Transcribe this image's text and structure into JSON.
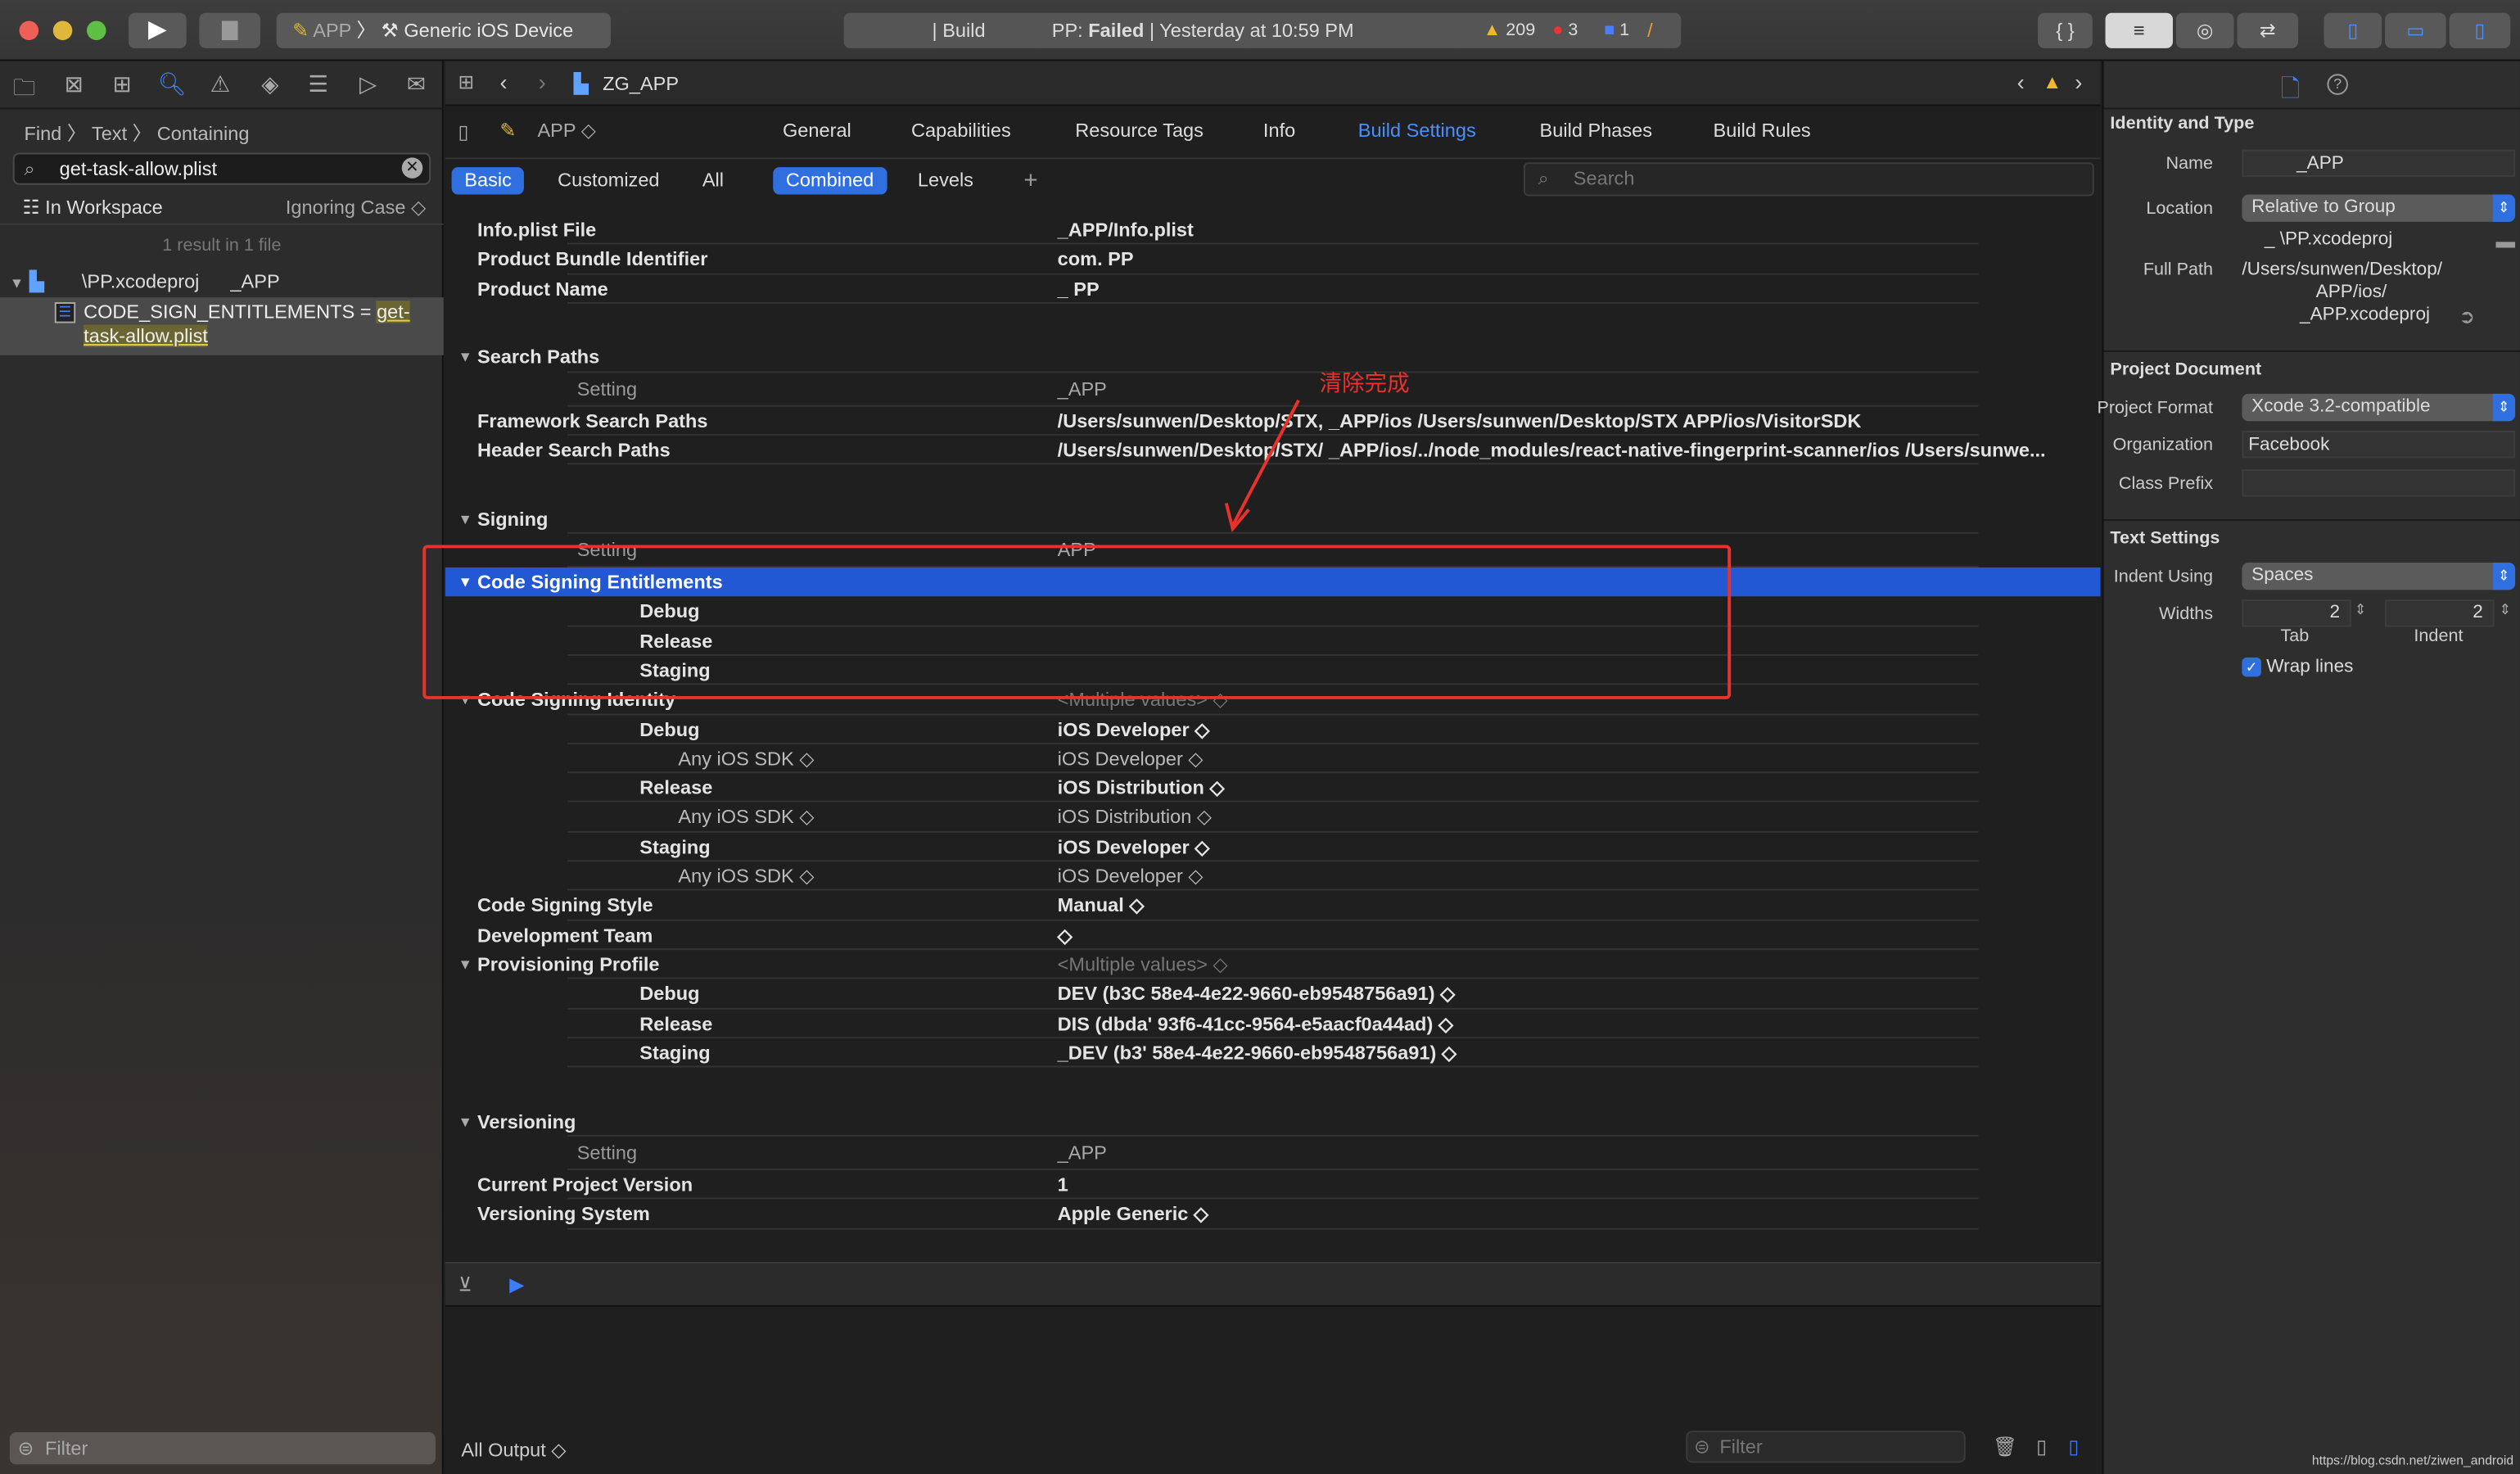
{
  "titlebar": {
    "scheme": "APP",
    "device": "Generic iOS Device",
    "activity": {
      "prefix": "| Build",
      "project": "PP:",
      "status": "Failed",
      "time": "| Yesterday at 10:59 PM"
    },
    "warnings": "209",
    "errors": "3",
    "issues": "1"
  },
  "navigator": {
    "breadcrumb": [
      "Find",
      "Text",
      "Containing"
    ],
    "search_value": "get-task-allow.plist",
    "scope": "In Workspace",
    "case": "Ignoring Case",
    "result_summary": "1 result in 1 file",
    "result_file": "\\PP.xcodeproj",
    "result_file_target": "_APP",
    "result_match_prefix": "CODE_SIGN_ENTITLEMENTS = ",
    "result_match_highlight": "get-task-allow.plist",
    "filter_placeholder": "Filter"
  },
  "editor": {
    "jump_file": "ZG_APP",
    "target": "APP",
    "tabs": [
      "General",
      "Capabilities",
      "Resource Tags",
      "Info",
      "Build Settings",
      "Build Phases",
      "Build Rules"
    ],
    "active_tab": "Build Settings",
    "filters": [
      "Basic",
      "Customized",
      "All"
    ],
    "active_filter": "Basic",
    "views": [
      "Combined",
      "Levels"
    ],
    "active_view": "Combined",
    "add": "+",
    "search_placeholder": "Search",
    "rows": [
      {
        "type": "row",
        "label": "Info.plist File",
        "value": "_APP/Info.plist",
        "first": true
      },
      {
        "type": "row",
        "label": "Product Bundle Identifier",
        "value": "com.        PP"
      },
      {
        "type": "row",
        "label": "Product Name",
        "value": "_ PP"
      },
      {
        "type": "section",
        "label": "Search Paths"
      },
      {
        "type": "setting",
        "label": "Setting",
        "value": "_APP"
      },
      {
        "type": "row",
        "label": "Framework Search Paths",
        "value": "/Users/sunwen/Desktop/STX,     _APP/ios /Users/sunwen/Desktop/STX       APP/ios/VisitorSDK"
      },
      {
        "type": "row",
        "label": "Header Search Paths",
        "value": "/Users/sunwen/Desktop/STX/   _APP/ios/../node_modules/react-native-fingerprint-scanner/ios /Users/sunwe..."
      },
      {
        "type": "section",
        "label": "Signing"
      },
      {
        "type": "setting",
        "label": "Setting",
        "value": "APP"
      },
      {
        "type": "subsection",
        "label": "Code Signing Entitlements",
        "selected": true
      },
      {
        "type": "row",
        "level": 1,
        "label": "Debug",
        "value": ""
      },
      {
        "type": "row",
        "level": 1,
        "label": "Release",
        "value": ""
      },
      {
        "type": "row",
        "level": 1,
        "label": "Staging",
        "value": ""
      },
      {
        "type": "subsection",
        "label": "Code Signing Identity",
        "value": "<Multiple values> ◇",
        "muted": true
      },
      {
        "type": "row",
        "level": 1,
        "label": "Debug",
        "value": "iOS Developer ◇"
      },
      {
        "type": "row",
        "level": 2,
        "label": "Any iOS SDK ◇",
        "value": "iOS Developer ◇"
      },
      {
        "type": "row",
        "level": 1,
        "label": "Release",
        "value": "iOS Distribution ◇"
      },
      {
        "type": "row",
        "level": 2,
        "label": "Any iOS SDK ◇",
        "value": "iOS Distribution ◇"
      },
      {
        "type": "row",
        "level": 1,
        "label": "Staging",
        "value": "iOS Developer ◇"
      },
      {
        "type": "row",
        "level": 2,
        "label": "Any iOS SDK ◇",
        "value": "iOS Developer ◇"
      },
      {
        "type": "row",
        "label": "Code Signing Style",
        "value": "Manual ◇"
      },
      {
        "type": "row",
        "label": "Development Team",
        "value": "◇"
      },
      {
        "type": "subsection",
        "label": "Provisioning Profile",
        "value": "<Multiple values> ◇",
        "muted": true
      },
      {
        "type": "row",
        "level": 1,
        "label": "Debug",
        "value": "  DEV (b3C        58e4-4e22-9660-eb9548756a91) ◇"
      },
      {
        "type": "row",
        "level": 1,
        "label": "Release",
        "value": "  DIS (dbda'       93f6-41cc-9564-e5aacf0a44ad) ◇"
      },
      {
        "type": "row",
        "level": 1,
        "label": "Staging",
        "value": "  _DEV (b3'        58e4-4e22-9660-eb9548756a91) ◇"
      },
      {
        "type": "section",
        "label": "Versioning"
      },
      {
        "type": "setting",
        "label": "Setting",
        "value": "_APP"
      },
      {
        "type": "row",
        "label": "Current Project Version",
        "value": "1"
      },
      {
        "type": "row",
        "label": "Versioning System",
        "value": "Apple Generic ◇"
      }
    ],
    "annotation": {
      "text": "清除完成",
      "color": "#e8322b"
    },
    "console": {
      "output_selector": "All Output ◇",
      "filter_placeholder": "Filter"
    }
  },
  "inspector": {
    "identity_header": "Identity and Type",
    "name_label": "Name",
    "name_value": "_APP",
    "location_label": "Location",
    "location_value": "Relative to Group",
    "location_file": "_ \\PP.xcodeproj",
    "fullpath_label": "Full Path",
    "fullpath_value": [
      "/Users/sunwen/Desktop/",
      "APP/ios/",
      "_APP.xcodeproj"
    ],
    "project_header": "Project Document",
    "format_label": "Project Format",
    "format_value": "Xcode 3.2-compatible",
    "org_label": "Organization",
    "org_value": "Facebook",
    "prefix_label": "Class Prefix",
    "prefix_value": "",
    "text_header": "Text Settings",
    "indent_label": "Indent Using",
    "indent_value": "Spaces",
    "widths_label": "Widths",
    "tab_width": "2",
    "indent_width": "2",
    "tab_caption": "Tab",
    "indent_caption": "Indent",
    "wrap_label": "Wrap lines",
    "wrap_checked": true
  },
  "watermark": "https://blog.csdn.net/ziwen_android",
  "colors": {
    "accent": "#2f6fe0",
    "selection": "#2358d5",
    "annotation": "#e8322b"
  }
}
